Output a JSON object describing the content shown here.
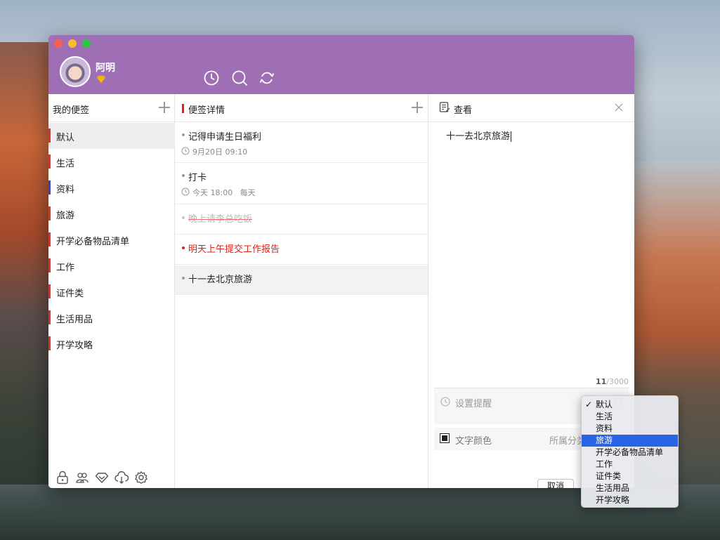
{
  "app": {
    "username": "阿明"
  },
  "sidebar": {
    "header": "我的便签",
    "categories": [
      {
        "label": "默认",
        "color": "#e0302a",
        "selected": true
      },
      {
        "label": "生活",
        "color": "#e0302a"
      },
      {
        "label": "资料",
        "color": "#3346c8"
      },
      {
        "label": "旅游",
        "color": "#e0302a"
      },
      {
        "label": "开学必备物品清单",
        "color": "#e0302a"
      },
      {
        "label": "工作",
        "color": "#e0302a"
      },
      {
        "label": "证件类",
        "color": "#e0302a"
      },
      {
        "label": "生活用品",
        "color": "#e0302a"
      },
      {
        "label": "开学攻略",
        "color": "#e0302a"
      }
    ],
    "bottom_icons": [
      "lock-icon",
      "contacts-icon",
      "diamond-icon",
      "cloud-download-icon",
      "settings-icon"
    ]
  },
  "notes_panel": {
    "header": "便签详情",
    "notes": [
      {
        "title": "记得申请生日福利",
        "time": "9月20日 09:10",
        "style": "normal"
      },
      {
        "title": "打卡",
        "time": "今天 18:00   每天",
        "style": "normal"
      },
      {
        "title": "晚上请李总吃饭",
        "time": "",
        "style": "done"
      },
      {
        "title": "明天上午提交工作报告",
        "time": "",
        "style": "red"
      },
      {
        "title": "十一去北京旅游",
        "time": "",
        "style": "normal",
        "selected": true
      }
    ]
  },
  "detail_panel": {
    "header": "查看",
    "content": "十一去北京旅游",
    "counter_current": "11",
    "counter_max": "/3000",
    "reminder_placeholder": "设置提醒",
    "text_color_label": "文字颜色",
    "category_label": "所属分类",
    "cancel_label": "取消"
  },
  "category_menu": {
    "items": [
      {
        "label": "默认",
        "checked": true
      },
      {
        "label": "生活"
      },
      {
        "label": "资料"
      },
      {
        "label": "旅游",
        "highlighted": true
      },
      {
        "label": "开学必备物品清单"
      },
      {
        "label": "工作"
      },
      {
        "label": "证件类"
      },
      {
        "label": "生活用品"
      },
      {
        "label": "开学攻略"
      }
    ],
    "check_mark": "✓"
  },
  "colors": {
    "titlebar": "#9e6fb5",
    "accent_red": "#e0201b",
    "highlight_blue": "#2b63e6"
  }
}
